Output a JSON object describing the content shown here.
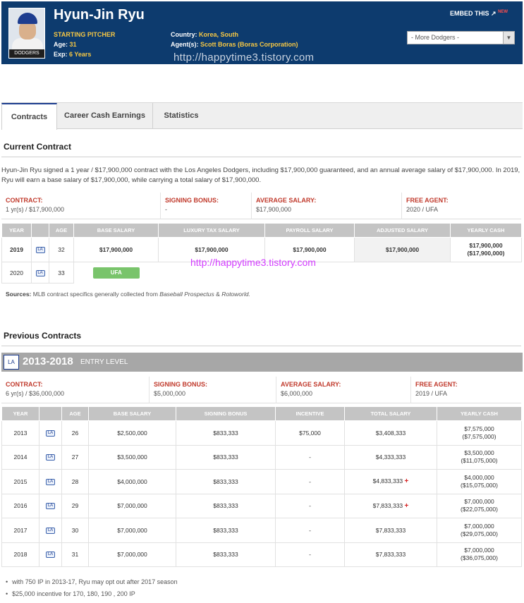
{
  "player": {
    "name": "Hyun-Jin Ryu",
    "position": "STARTING PITCHER",
    "age_label": "Age:",
    "age": "31",
    "exp_label": "Exp:",
    "exp": "6 Years",
    "country_label": "Country:",
    "country": "Korea, South",
    "agent_label": "Agent(s):",
    "agent": "Scott Boras (Boras Corporation)",
    "photo_tag": "DODGERS"
  },
  "header": {
    "embed": "EMBED THIS",
    "embed_new": "NEW",
    "team_select": "- More Dodgers -"
  },
  "watermark": "http://happytime3.tistory.com",
  "tabs": [
    "Contracts",
    "Career Cash Earnings",
    "Statistics"
  ],
  "current": {
    "title": "Current Contract",
    "description": "Hyun-Jin Ryu signed a 1 year / $17,900,000 contract with the Los Angeles Dodgers, including $17,900,000 guaranteed, and an annual average salary of $17,900,000. In 2019, Ryu will earn a base salary of $17,900,000, while carrying a total salary of $17,900,000.",
    "summary": [
      {
        "label": "CONTRACT:",
        "value": "1 yr(s) / $17,900,000"
      },
      {
        "label": "SIGNING BONUS:",
        "value": "-"
      },
      {
        "label": "AVERAGE SALARY:",
        "value": "$17,900,000"
      },
      {
        "label": "FREE AGENT:",
        "value": "2020 / UFA"
      }
    ],
    "columns": [
      "YEAR",
      "",
      "AGE",
      "BASE SALARY",
      "LUXURY TAX SALARY",
      "PAYROLL SALARY",
      "ADJUSTED SALARY",
      "YEARLY CASH"
    ],
    "rows": [
      {
        "year": "2019",
        "age": "32",
        "base": "$17,900,000",
        "lux": "$17,900,000",
        "payroll": "$17,900,000",
        "adjusted": "$17,900,000",
        "cash": "$17,900,000",
        "cash_cum": "($17,900,000)"
      },
      {
        "year": "2020",
        "age": "33",
        "status": "UFA"
      }
    ],
    "sources_label": "Sources:",
    "sources_text": "MLB contract specifics generally collected from",
    "source1": "Baseball Prospectus",
    "source_amp": "&",
    "source2": "Rotoworld."
  },
  "previous": {
    "title": "Previous Contracts",
    "years": "2013-2018",
    "type": "ENTRY LEVEL",
    "logo": "LA",
    "summary": [
      {
        "label": "CONTRACT:",
        "value": "6 yr(s) / $36,000,000"
      },
      {
        "label": "SIGNING BONUS:",
        "value": "$5,000,000"
      },
      {
        "label": "AVERAGE SALARY:",
        "value": "$6,000,000"
      },
      {
        "label": "FREE AGENT:",
        "value": "2019 / UFA"
      }
    ],
    "columns": [
      "YEAR",
      "",
      "AGE",
      "BASE SALARY",
      "SIGNING BONUS",
      "INCENTIVE",
      "TOTAL SALARY",
      "YEARLY CASH"
    ],
    "rows": [
      {
        "year": "2013",
        "age": "26",
        "base": "$2,500,000",
        "bonus": "$833,333",
        "incentive": "$75,000",
        "total": "$3,408,333",
        "plus": false,
        "cash": "$7,575,000",
        "cum": "($7,575,000)"
      },
      {
        "year": "2014",
        "age": "27",
        "base": "$3,500,000",
        "bonus": "$833,333",
        "incentive": "-",
        "total": "$4,333,333",
        "plus": false,
        "cash": "$3,500,000",
        "cum": "($11,075,000)"
      },
      {
        "year": "2015",
        "age": "28",
        "base": "$4,000,000",
        "bonus": "$833,333",
        "incentive": "-",
        "total": "$4,833,333",
        "plus": true,
        "cash": "$4,000,000",
        "cum": "($15,075,000)"
      },
      {
        "year": "2016",
        "age": "29",
        "base": "$7,000,000",
        "bonus": "$833,333",
        "incentive": "-",
        "total": "$7,833,333",
        "plus": true,
        "cash": "$7,000,000",
        "cum": "($22,075,000)"
      },
      {
        "year": "2017",
        "age": "30",
        "base": "$7,000,000",
        "bonus": "$833,333",
        "incentive": "-",
        "total": "$7,833,333",
        "plus": false,
        "cash": "$7,000,000",
        "cum": "($29,075,000)"
      },
      {
        "year": "2018",
        "age": "31",
        "base": "$7,000,000",
        "bonus": "$833,333",
        "incentive": "-",
        "total": "$7,833,333",
        "plus": false,
        "cash": "$7,000,000",
        "cum": "($36,075,000)"
      }
    ],
    "notes": [
      "with 750 IP in 2013-17, Ryu may opt out after 2017 season",
      "$25,000 incentive for 170, 180, 190 , 200 IP"
    ]
  },
  "icons": {
    "team_logo": "dodgers-logo-icon",
    "plus": "plus-icon",
    "embed": "share-icon",
    "dropdown": "chevron-down-icon"
  },
  "colors": {
    "header_bg": "#0d3b6e",
    "accent_yellow": "#f6c744",
    "label_red": "#c0392b",
    "ufa_green": "#79c46b"
  }
}
